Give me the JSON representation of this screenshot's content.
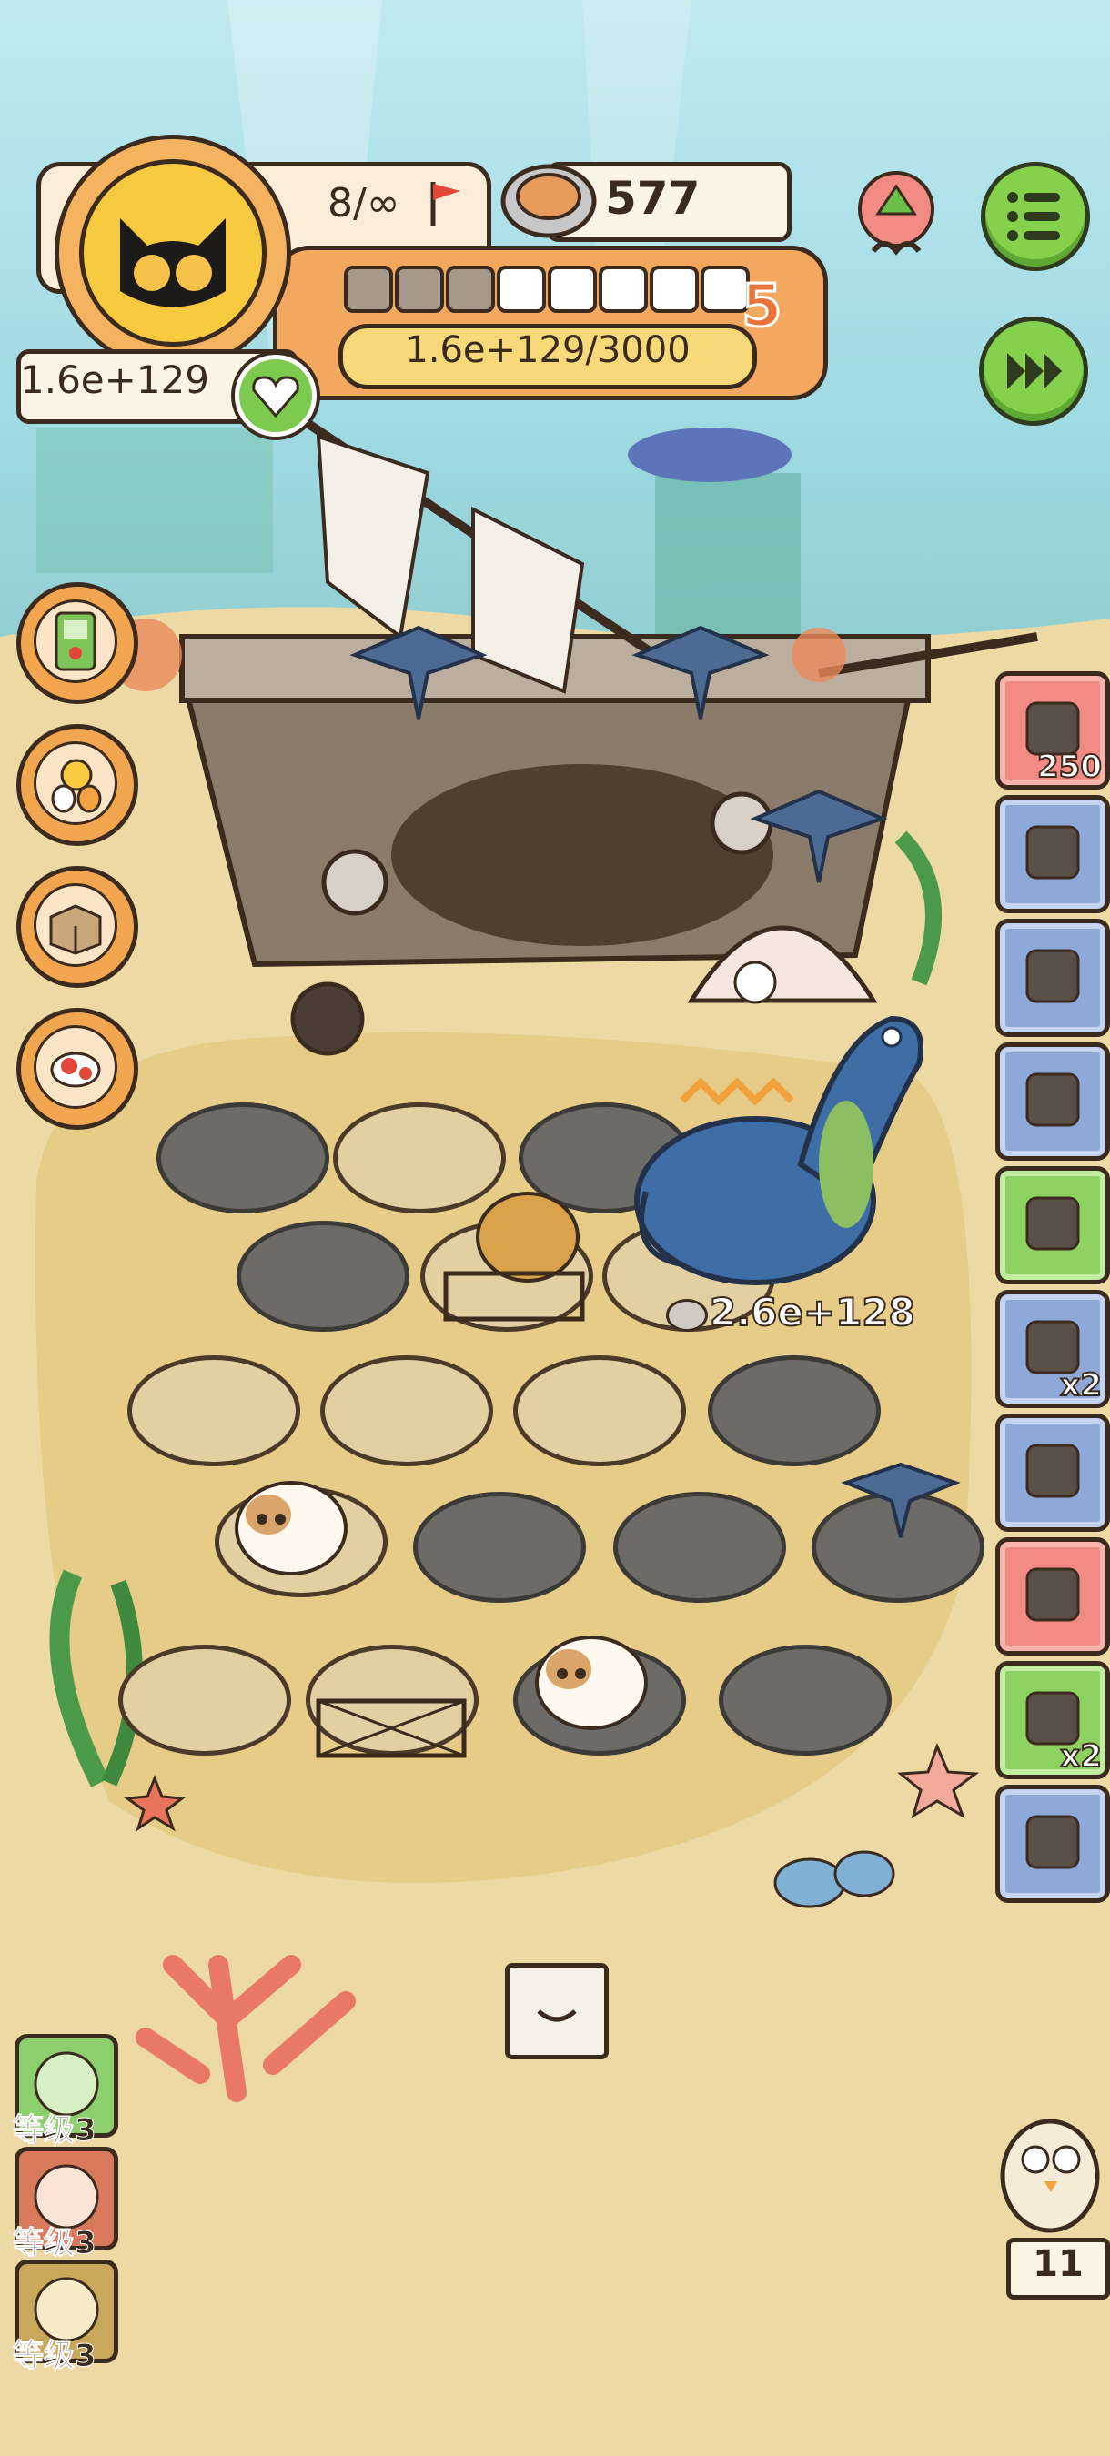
{
  "hud": {
    "level_count": "8/∞",
    "cans": "577",
    "xp_text": "1.6e+129/3000",
    "level": "5",
    "currency": "1.6e+129",
    "segments_filled": 3,
    "segments_total": 8
  },
  "scene": {
    "dino_price": "2.6e+128"
  },
  "right_slots": [
    {
      "icon": "snack-bowl-icon",
      "color": "red",
      "badge": "250"
    },
    {
      "icon": "camera-icon",
      "color": "blue",
      "badge": ""
    },
    {
      "icon": "jar-icon",
      "color": "blue",
      "badge": ""
    },
    {
      "icon": "plant-icon",
      "color": "blue",
      "badge": ""
    },
    {
      "icon": "card-icon",
      "color": "green",
      "badge": ""
    },
    {
      "icon": "can-icon",
      "color": "blue",
      "badge": "x2"
    },
    {
      "icon": "mouse-toy-icon",
      "color": "blue",
      "badge": ""
    },
    {
      "icon": "ore-icon",
      "color": "red",
      "badge": ""
    },
    {
      "icon": "ticket-icon",
      "color": "green",
      "badge": "x2"
    },
    {
      "icon": "basket-icon",
      "color": "blue",
      "badge": ""
    }
  ],
  "left_buttons": [
    "gameboy-icon",
    "chick-eggs-icon",
    "box-icon",
    "koi-icon"
  ],
  "skills": [
    {
      "label": "等级3",
      "icon": "skill-green-icon"
    },
    {
      "label": "等级3",
      "icon": "skill-red-icon"
    },
    {
      "label": "等级3",
      "icon": "skill-gold-icon"
    }
  ],
  "counter": "11",
  "colors": {
    "accent_orange": "#f2a85f",
    "button_green": "#86d14c",
    "slot_blue": "#8ea8d8",
    "slot_red": "#f08a82",
    "slot_green": "#8dd161"
  }
}
